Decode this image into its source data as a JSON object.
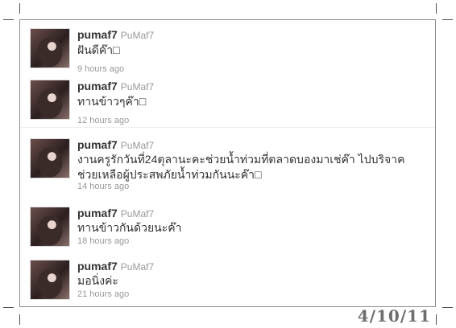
{
  "tweets": [
    {
      "username": "pumaf7",
      "handle": "PuMaf7",
      "text": "ฝันดีค๊า□",
      "time": "9 hours ago"
    },
    {
      "username": "pumaf7",
      "handle": "PuMaf7",
      "text": "ทานข้าวๆค๊า□",
      "time": "12 hours ago"
    },
    {
      "username": "pumaf7",
      "handle": "PuMaf7",
      "text": "งานครูรักวันที่24ตุลานะคะช่วยน้ำท่วมที่ตลาดบองมาเช่ค๊า ไปบริจาคช่วยเหลือผู้ประสพภัยน้ำท่วมกันนะค๊า□",
      "time": "14 hours ago"
    },
    {
      "username": "pumaf7",
      "handle": "PuMaf7",
      "text": "ทานข้าวกันด้วยนะค๊า",
      "time": "18 hours ago"
    },
    {
      "username": "pumaf7",
      "handle": "PuMaf7",
      "text": "มอนิ่งค่ะ",
      "time": "21 hours ago"
    }
  ],
  "date_stamp": "4/10/11"
}
